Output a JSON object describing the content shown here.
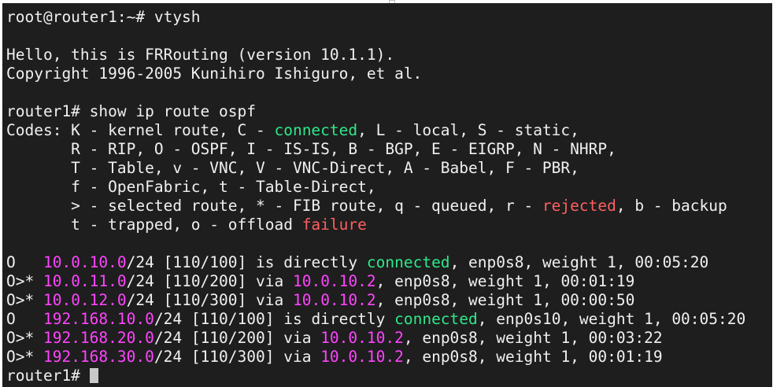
{
  "terminal": {
    "prompt_cmd": "root@router1:~# vtysh",
    "hello": "Hello, this is FRRouting (version 10.1.1).",
    "copyright": "Copyright 1996-2005 Kunihiro Ishiguro, et al.",
    "show_cmd": "router1# show ip route ospf",
    "codes": {
      "l1_a": "Codes: K - kernel route, C - ",
      "l1_connected": "connected",
      "l1_b": ", L - local, S - static,",
      "l2": "       R - RIP, O - OSPF, I - IS-IS, B - BGP, E - EIGRP, N - NHRP,",
      "l3": "       T - Table, v - VNC, V - VNC-Direct, A - Babel, F - PBR,",
      "l4": "       f - OpenFabric, t - Table-Direct,",
      "l5_a": "       > - selected route, * - FIB route, q - queued, r - ",
      "l5_rejected": "rejected",
      "l5_b": ", b - backup",
      "l6_a": "       t - trapped, o - offload ",
      "l6_failure": "failure"
    },
    "routes": [
      {
        "code": "O   ",
        "net": "10.0.10.0",
        "rest": "/24 [110/100] is directly ",
        "connected": "connected",
        "tail": ", enp0s8, weight 1, 00:05:20"
      },
      {
        "code": "O>* ",
        "net": "10.0.11.0",
        "rest": "/24 [110/200] via ",
        "via": "10.0.10.2",
        "tail": ", enp0s8, weight 1, 00:01:19"
      },
      {
        "code": "O>* ",
        "net": "10.0.12.0",
        "rest": "/24 [110/300] via ",
        "via": "10.0.10.2",
        "tail": ", enp0s8, weight 1, 00:00:50"
      },
      {
        "code": "O   ",
        "net": "192.168.10.0",
        "rest": "/24 [110/100] is directly ",
        "connected": "connected",
        "tail": ", enp0s10, weight 1, 00:05:20"
      },
      {
        "code": "O>* ",
        "net": "192.168.20.0",
        "rest": "/24 [110/200] via ",
        "via": "10.0.10.2",
        "tail": ", enp0s8, weight 1, 00:03:22"
      },
      {
        "code": "O>* ",
        "net": "192.168.30.0",
        "rest": "/24 [110/300] via ",
        "via": "10.0.10.2",
        "tail": ", enp0s8, weight 1, 00:01:19"
      }
    ],
    "final_prompt": "router1# "
  },
  "colors": {
    "background": "#1e1e1e",
    "text": "#f0f0f0",
    "green": "#2ee88a",
    "red": "#ff5f5f",
    "magenta": "#ff44ff"
  }
}
